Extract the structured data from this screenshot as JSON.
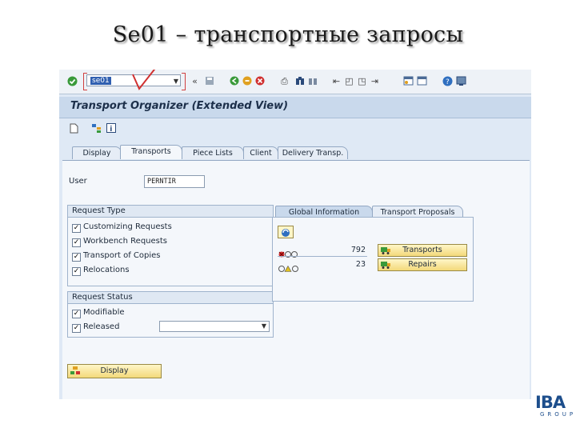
{
  "slide": {
    "title": "Se01 – транспортные запросы"
  },
  "toolbar": {
    "tcode_value": "se01",
    "colors": {
      "accent": "#1c2f4a",
      "button": "#f3d97a",
      "panel": "#dfe9f5"
    }
  },
  "window": {
    "title": "Transport Organizer (Extended View)"
  },
  "tabs": [
    {
      "label": "Display"
    },
    {
      "label": "Transports"
    },
    {
      "label": "Piece Lists"
    },
    {
      "label": "Client"
    },
    {
      "label": "Delivery Transp."
    }
  ],
  "user": {
    "label": "User",
    "value": "PERNTIR"
  },
  "request_type": {
    "title": "Request Type",
    "items": [
      {
        "label": "Customizing Requests",
        "checked": true
      },
      {
        "label": "Workbench Requests",
        "checked": true
      },
      {
        "label": "Transport of Copies",
        "checked": true
      },
      {
        "label": "Relocations",
        "checked": true
      }
    ]
  },
  "request_status": {
    "title": "Request Status",
    "items": [
      {
        "label": "Modifiable",
        "checked": true
      },
      {
        "label": "Released",
        "checked": true
      }
    ]
  },
  "info_tabs": [
    {
      "label": "Global Information"
    },
    {
      "label": "Transport Proposals"
    }
  ],
  "stats": [
    {
      "count": "792",
      "button": "Transports"
    },
    {
      "count": "23",
      "button": "Repairs"
    }
  ],
  "display_button": "Display",
  "logo": {
    "main": "IBA",
    "sub": "GROUP"
  }
}
